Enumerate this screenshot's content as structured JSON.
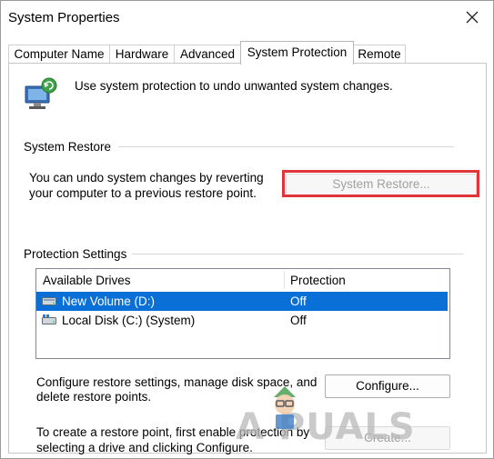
{
  "window": {
    "title": "System Properties",
    "close_icon": "close-icon"
  },
  "tabs": [
    {
      "label": "Computer Name"
    },
    {
      "label": "Hardware"
    },
    {
      "label": "Advanced"
    },
    {
      "label": "System Protection",
      "active": true
    },
    {
      "label": "Remote"
    }
  ],
  "intro": {
    "icon": "computer-restore-icon",
    "text": "Use system protection to undo unwanted system changes."
  },
  "system_restore": {
    "group_label": "System Restore",
    "description_line1": "You can undo system changes by reverting",
    "description_line2": "your computer to a previous restore point.",
    "button_label": "System Restore...",
    "highlight_color": "#e0333a"
  },
  "protection_settings": {
    "group_label": "Protection Settings",
    "columns": [
      "Available Drives",
      "Protection"
    ],
    "drives": [
      {
        "name": "New Volume (D:)",
        "protection": "Off",
        "selected": true,
        "icon": "drive-icon"
      },
      {
        "name": "Local Disk (C:) (System)",
        "protection": "Off",
        "selected": false,
        "icon": "system-drive-icon"
      }
    ],
    "selection_color": "#0a6fd6",
    "configure_text_line1": "Configure restore settings, manage disk space, and",
    "configure_text_line2": "delete restore points.",
    "configure_button": "Configure...",
    "create_text_line1": "To create a restore point, first enable protection by",
    "create_text_line2": "selecting a drive and clicking Configure.",
    "create_button": "Create..."
  },
  "watermark": {
    "text": "A PUALS"
  }
}
